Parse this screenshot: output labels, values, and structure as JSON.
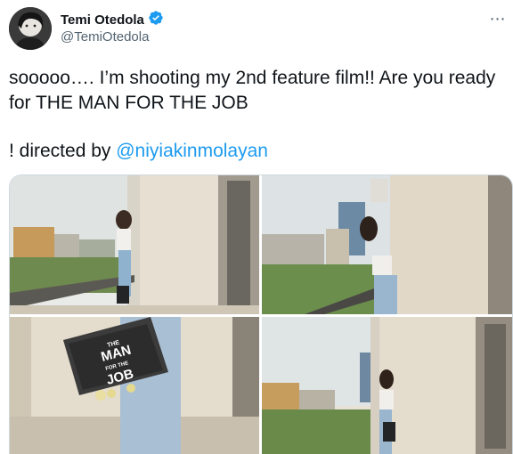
{
  "author": {
    "name": "Temi Otedola",
    "handle": "@TemiOtedola",
    "verified": true
  },
  "more_icon": "⋯",
  "tweet": {
    "line1": "sooooo…. I’m shooting my 2nd feature film!! Are you ready for THE MAN FOR THE JOB",
    "line2_prefix": "! directed by ",
    "mention": "@niyiakinmolayan"
  },
  "book": {
    "the": "THE",
    "man": "MAN",
    "for_the": "FOR THE",
    "job": "JOB"
  },
  "colors": {
    "link": "#1d9bf0",
    "verified_badge": "#1d9bf0",
    "secondary_text": "#536471",
    "border": "#cfd9de"
  },
  "icons": [
    "verified-badge-icon",
    "more-options-icon"
  ]
}
